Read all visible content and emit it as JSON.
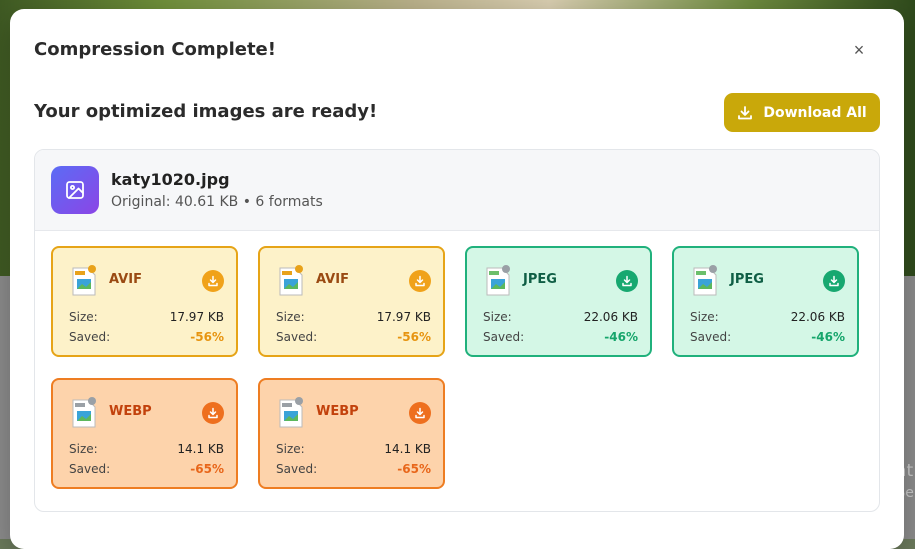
{
  "modal": {
    "title": "Compression Complete!",
    "close_symbol": "×",
    "ready_text": "Your optimized images are ready!",
    "download_all_label": "Download All"
  },
  "file": {
    "name": "katy1020.jpg",
    "meta": "Original: 40.61 KB • 6 formats"
  },
  "formats": [
    {
      "name": "AVIF",
      "size_label": "Size:",
      "size": "17.97 KB",
      "saved_label": "Saved:",
      "saved": "-56%"
    },
    {
      "name": "AVIF",
      "size_label": "Size:",
      "size": "17.97 KB",
      "saved_label": "Saved:",
      "saved": "-56%"
    },
    {
      "name": "JPEG",
      "size_label": "Size:",
      "size": "22.06 KB",
      "saved_label": "Saved:",
      "saved": "-46%"
    },
    {
      "name": "JPEG",
      "size_label": "Size:",
      "size": "22.06 KB",
      "saved_label": "Saved:",
      "saved": "-46%"
    },
    {
      "name": "WEBP",
      "size_label": "Size:",
      "size": "14.1 KB",
      "saved_label": "Saved:",
      "saved": "-65%"
    },
    {
      "name": "WEBP",
      "size_label": "Size:",
      "size": "14.1 KB",
      "saved_label": "Saved:",
      "saved": "-65%"
    }
  ],
  "colors": {
    "download_all_bg": "#c9a80a",
    "avif_border": "#e6a417",
    "jpeg_border": "#20b17c",
    "webp_border": "#ee7d22"
  },
  "watermark": {
    "line1": "Activat",
    "line2": "Go to Se"
  },
  "icons": {
    "close": "close-icon",
    "download": "download-icon",
    "image": "image-icon",
    "file": "image-file-icon"
  }
}
